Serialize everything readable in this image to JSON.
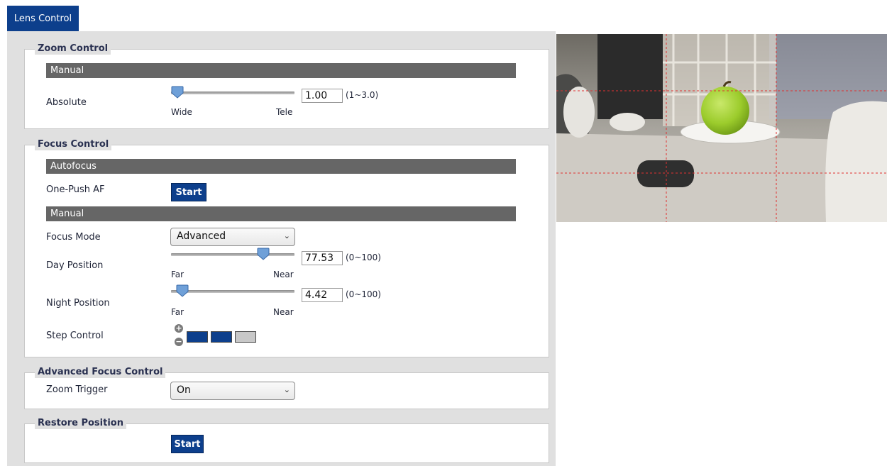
{
  "tab": {
    "label": "Lens Control"
  },
  "zoom": {
    "legend": "Zoom Control",
    "manual_bar": "Manual",
    "absolute_label": "Absolute",
    "left_label": "Wide",
    "right_label": "Tele",
    "value": "1.00",
    "range": "(1~3.0)",
    "level": 0.0
  },
  "focus": {
    "legend": "Focus Control",
    "autofocus_bar": "Autofocus",
    "one_push_label": "One-Push AF",
    "start_label": "Start",
    "manual_bar": "Manual",
    "mode_label": "Focus Mode",
    "mode_value": "Advanced",
    "day_label": "Day Position",
    "day_value": "77.53",
    "day_range": "(0~100)",
    "day_level": 0.7753,
    "night_label": "Night Position",
    "night_value": "4.42",
    "night_range": "(0~100)",
    "night_level": 0.0442,
    "far_label": "Far",
    "near_label": "Near",
    "step_label": "Step Control",
    "step_filled": 2,
    "step_total": 3
  },
  "advanced": {
    "legend": "Advanced Focus Control",
    "zoom_trigger_label": "Zoom Trigger",
    "zoom_trigger_value": "On"
  },
  "restore": {
    "legend": "Restore Position",
    "start_label": "Start"
  },
  "colors": {
    "accent": "#0d3f8c",
    "bar": "#666666",
    "panel": "#e0e0e0"
  }
}
